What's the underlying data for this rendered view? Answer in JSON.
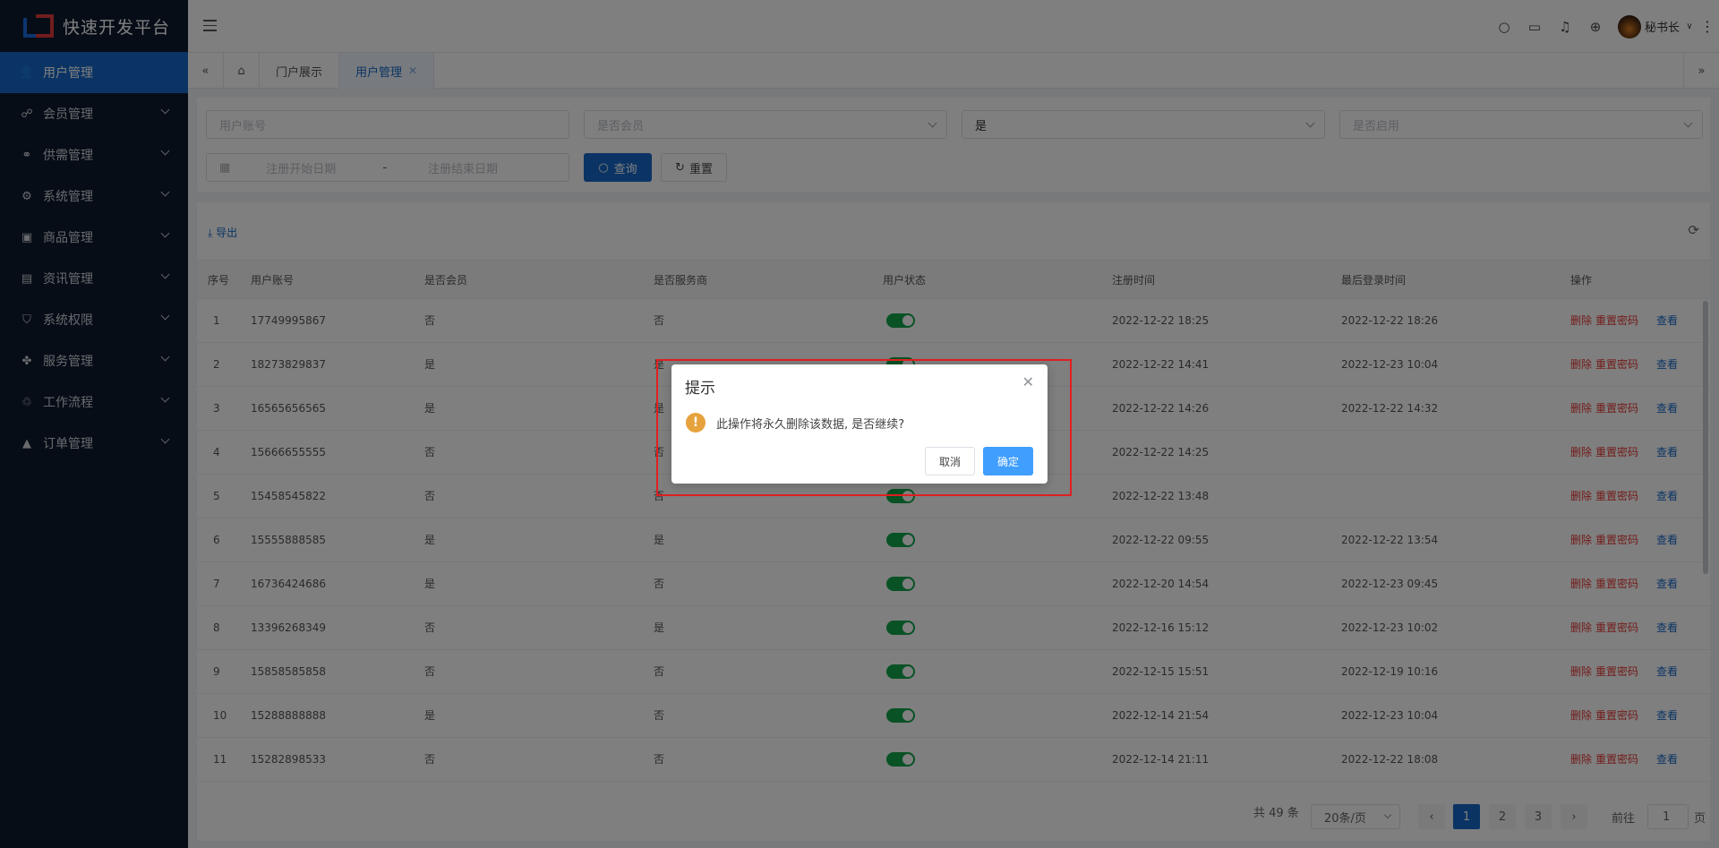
{
  "app": {
    "title": "快速开发平台"
  },
  "sidebar": {
    "items": [
      {
        "label": "用户管理",
        "icon": "user-icon",
        "glyph": "👤",
        "active": true
      },
      {
        "label": "会员管理",
        "icon": "network-icon",
        "glyph": "☍"
      },
      {
        "label": "供需管理",
        "icon": "grid-circles-icon",
        "glyph": "⚭"
      },
      {
        "label": "系统管理",
        "icon": "gear-icon",
        "glyph": "⚙"
      },
      {
        "label": "商品管理",
        "icon": "search-box-icon",
        "glyph": "▣"
      },
      {
        "label": "资讯管理",
        "icon": "document-icon",
        "glyph": "▤"
      },
      {
        "label": "系统权限",
        "icon": "shield-icon",
        "glyph": "⛉"
      },
      {
        "label": "服务管理",
        "icon": "apps-icon",
        "glyph": "✤"
      },
      {
        "label": "工作流程",
        "icon": "flow-icon",
        "glyph": "♲"
      },
      {
        "label": "订单管理",
        "icon": "triangle-icon",
        "glyph": "▲"
      }
    ]
  },
  "header": {
    "username": "秘书长"
  },
  "tabs": [
    {
      "label": "门户展示"
    },
    {
      "label": "用户管理",
      "active": true
    }
  ],
  "search": {
    "account_placeholder": "用户账号",
    "member_placeholder": "是否会员",
    "provider_value": "是",
    "enabled_placeholder": "是否启用",
    "date_start_placeholder": "注册开始日期",
    "date_sep": "-",
    "date_end_placeholder": "注册结束日期",
    "query_label": "查询",
    "reset_label": "重置"
  },
  "toolbar": {
    "export_label": "导出"
  },
  "table": {
    "columns": [
      "序号",
      "用户账号",
      "是否会员",
      "是否服务商",
      "用户状态",
      "注册时间",
      "最后登录时间",
      "操作"
    ],
    "actions": {
      "delete": "删除",
      "reset": "重置密码",
      "view": "查看"
    },
    "rows": [
      {
        "no": "1",
        "account": "17749995867",
        "member": "否",
        "provider": "否",
        "reg": "2022-12-22 18:25",
        "last": "2022-12-22 18:26"
      },
      {
        "no": "2",
        "account": "18273829837",
        "member": "是",
        "provider": "是",
        "reg": "2022-12-22 14:41",
        "last": "2022-12-23 10:04"
      },
      {
        "no": "3",
        "account": "16565656565",
        "member": "是",
        "provider": "是",
        "reg": "2022-12-22 14:26",
        "last": "2022-12-22 14:32"
      },
      {
        "no": "4",
        "account": "15666655555",
        "member": "否",
        "provider": "否",
        "reg": "2022-12-22 14:25",
        "last": ""
      },
      {
        "no": "5",
        "account": "15458545822",
        "member": "否",
        "provider": "否",
        "reg": "2022-12-22 13:48",
        "last": ""
      },
      {
        "no": "6",
        "account": "15555888585",
        "member": "是",
        "provider": "是",
        "reg": "2022-12-22 09:55",
        "last": "2022-12-22 13:54"
      },
      {
        "no": "7",
        "account": "16736424686",
        "member": "是",
        "provider": "否",
        "reg": "2022-12-20 14:54",
        "last": "2022-12-23 09:45"
      },
      {
        "no": "8",
        "account": "13396268349",
        "member": "否",
        "provider": "是",
        "reg": "2022-12-16 15:12",
        "last": "2022-12-23 10:02"
      },
      {
        "no": "9",
        "account": "15858585858",
        "member": "否",
        "provider": "否",
        "reg": "2022-12-15 15:51",
        "last": "2022-12-19 10:16"
      },
      {
        "no": "10",
        "account": "15288888888",
        "member": "是",
        "provider": "否",
        "reg": "2022-12-14 21:54",
        "last": "2022-12-23 10:04"
      },
      {
        "no": "11",
        "account": "15282898533",
        "member": "否",
        "provider": "否",
        "reg": "2022-12-14 21:11",
        "last": "2022-12-22 18:08"
      }
    ]
  },
  "pagination": {
    "total": "共 49 条",
    "page_size": "20条/页",
    "pages": [
      "1",
      "2",
      "3"
    ],
    "current": "1",
    "goto_prefix": "前往",
    "goto_value": "1",
    "goto_suffix": "页"
  },
  "dialog": {
    "title": "提示",
    "message": "此操作将永久删除该数据, 是否继续?",
    "cancel": "取消",
    "confirm": "确定"
  },
  "colors": {
    "sidebar_bg": "#0d1b2e",
    "primary": "#1668c9",
    "switch_on": "#13a54a",
    "danger": "#e53935",
    "warning": "#e6a23c",
    "highlight": "#e02020"
  }
}
